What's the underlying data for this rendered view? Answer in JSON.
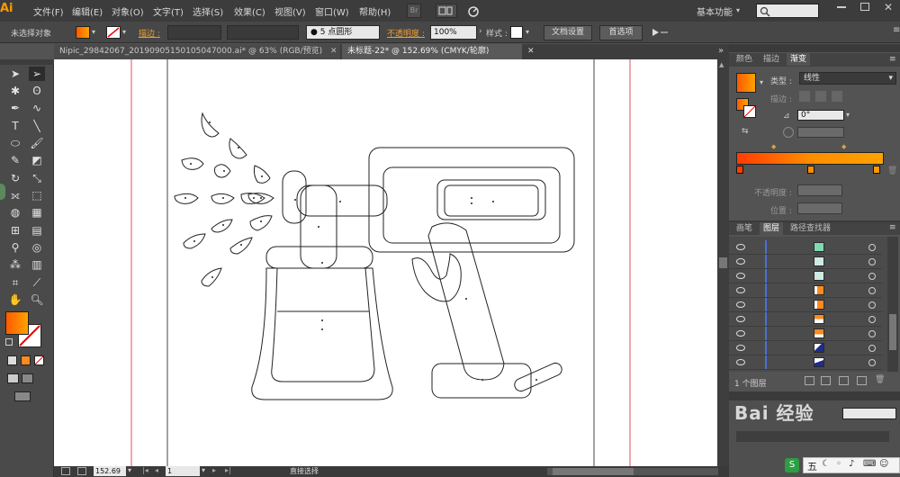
{
  "menubar": {
    "logo": "Ai",
    "items": [
      "文件(F)",
      "编辑(E)",
      "对象(O)",
      "文字(T)",
      "选择(S)",
      "效果(C)",
      "视图(V)",
      "窗口(W)",
      "帮助(H)"
    ],
    "workspace": "基本功能"
  },
  "controlbar": {
    "selection": "未选择对象",
    "stroke_label": "描边 :",
    "brush": "5 点圆形",
    "opacity_label": "不透明度 :",
    "opacity_value": "100%",
    "style_label": "样式 :",
    "doc_setup": "文档设置",
    "preferences": "首选项"
  },
  "tabs": [
    {
      "label": "Nipic_29842067_20190905150105047000.ai* @ 63% (RGB/预览)"
    },
    {
      "label": "未标题-22* @ 152.69% (CMYK/轮廓)"
    }
  ],
  "panel": {
    "tabs": [
      "颜色",
      "描边",
      "渐变"
    ],
    "type_label": "类型 :",
    "type_value": "线性",
    "stroke_label": "描边 :",
    "angle_value": "0°",
    "opacity_label": "不透明度 :",
    "position_label": "位置 :",
    "gradient_stops": [
      "#ff3c00",
      "#ff8c00",
      "#ff9a00"
    ]
  },
  "layers": {
    "tabs": [
      "画笔",
      "图层",
      "路径查找器"
    ],
    "count": "1 个图层",
    "thumbs": [
      "#7fd8b0",
      "#cfe9e5",
      "#cfe9e5",
      "#ff8a1e",
      "#ff8a1e",
      "#ff8a1e",
      "#ff8a1e",
      "#1e2d8a",
      "#1e2d8a"
    ]
  },
  "status": {
    "zoom": "152.69",
    "page": "1",
    "tool": "直接选择"
  },
  "watermark": {
    "logo": "Bai 经验",
    "bottom_tag": "五"
  },
  "colors": {
    "fill_gradient_start": "#ff5a00",
    "fill_gradient_end": "#ffa200",
    "accent": "#ff9a00"
  }
}
